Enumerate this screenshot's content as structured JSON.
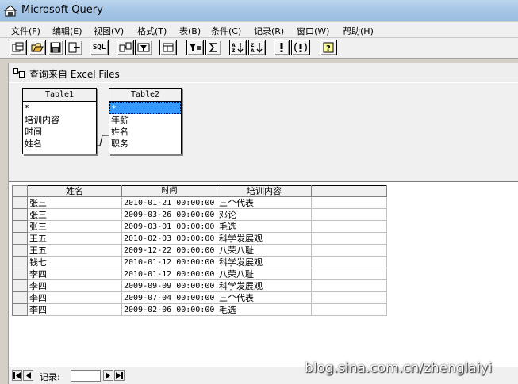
{
  "window": {
    "title": "Microsoft Query"
  },
  "menu": [
    "文件(F)",
    "编辑(E)",
    "视图(V)",
    "格式(T)",
    "表(B)",
    "条件(C)",
    "记录(R)",
    "窗口(W)",
    "帮助(H)"
  ],
  "toolbar": {
    "sql_label": "SQL",
    "buttons": [
      "new-query-icon",
      "open-icon",
      "save-icon",
      "return-data-icon",
      "sql-button",
      "show-tables-icon",
      "show-criteria-icon",
      "add-tables-icon",
      "criteria-equals-icon",
      "totals-icon",
      "sort-ascending-icon",
      "sort-descending-icon",
      "query-now-icon",
      "auto-query-icon",
      "help-icon"
    ]
  },
  "query_window": {
    "title": "查询来自 Excel Files"
  },
  "tables": [
    {
      "name": "Table1",
      "fields": [
        "*",
        "培训内容",
        "时间",
        "姓名"
      ]
    },
    {
      "name": "Table2",
      "fields": [
        "*",
        "年薪",
        "姓名",
        "职务"
      ],
      "selected_index": 0
    }
  ],
  "grid": {
    "headers": [
      "姓名",
      "时间",
      "培训内容",
      ""
    ],
    "rows": [
      [
        "张三",
        "2010-01-21 00:00:00",
        "三个代表"
      ],
      [
        "张三",
        "2009-03-26 00:00:00",
        "邓论"
      ],
      [
        "张三",
        "2009-03-01 00:00:00",
        "毛选"
      ],
      [
        "王五",
        "2010-02-03 00:00:00",
        "科学发展观"
      ],
      [
        "王五",
        "2009-12-22 00:00:00",
        "八荣八耻"
      ],
      [
        "钱七",
        "2010-01-12 00:00:00",
        "科学发展观"
      ],
      [
        "李四",
        "2010-01-12 00:00:00",
        "八荣八耻"
      ],
      [
        "李四",
        "2009-09-09 00:00:00",
        "科学发展观"
      ],
      [
        "李四",
        "2009-07-04 00:00:00",
        "三个代表"
      ],
      [
        "李四",
        "2009-02-06 00:00:00",
        "毛选"
      ]
    ]
  },
  "navigator": {
    "label": "记录:",
    "value": ""
  },
  "watermark": "blog.sina.com.cn/zhenglaiyi"
}
